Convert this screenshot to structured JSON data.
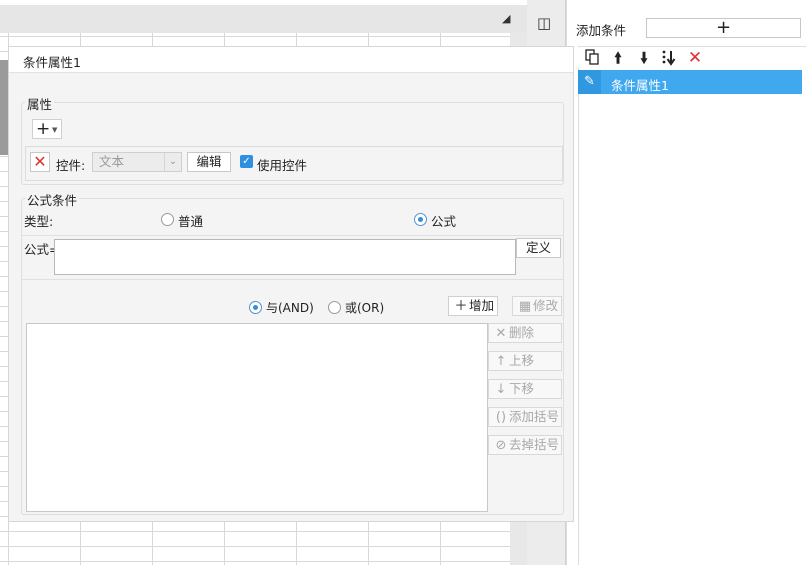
{
  "right_panel": {
    "add_condition_label": "添加条件",
    "add_button": "+",
    "toolbar_icons": [
      "copy-icon",
      "arrow-up-icon",
      "arrow-down-icon",
      "move-bottom-icon",
      "delete-icon"
    ],
    "items": [
      {
        "label": "条件属性1",
        "selected": true
      }
    ]
  },
  "dialog": {
    "title": "条件属性1",
    "attributes": {
      "title": "属性",
      "add_symbol": "+",
      "control_label": "控件:",
      "control_value": "文本",
      "edit_button": "编辑",
      "use_control_label": "使用控件",
      "use_control_checked": true
    },
    "formula_condition": {
      "title": "公式条件",
      "type_label": "类型:",
      "type_options": [
        "普通",
        "公式"
      ],
      "type_selected": "公式",
      "formula_label": "公式=",
      "formula_value": "",
      "define_button": "定义",
      "logic_options": [
        "与(AND)",
        "或(OR)"
      ],
      "logic_selected": "与(AND)",
      "buttons": {
        "add": "增加",
        "modify": "修改",
        "delete": "删除",
        "move_up": "上移",
        "move_down": "下移",
        "add_paren": "添加括号",
        "remove_paren": "去掉括号"
      }
    }
  },
  "colors": {
    "accent": "#3fa8ee",
    "delete_red": "#e03030",
    "check_blue": "#2f8fe0"
  }
}
